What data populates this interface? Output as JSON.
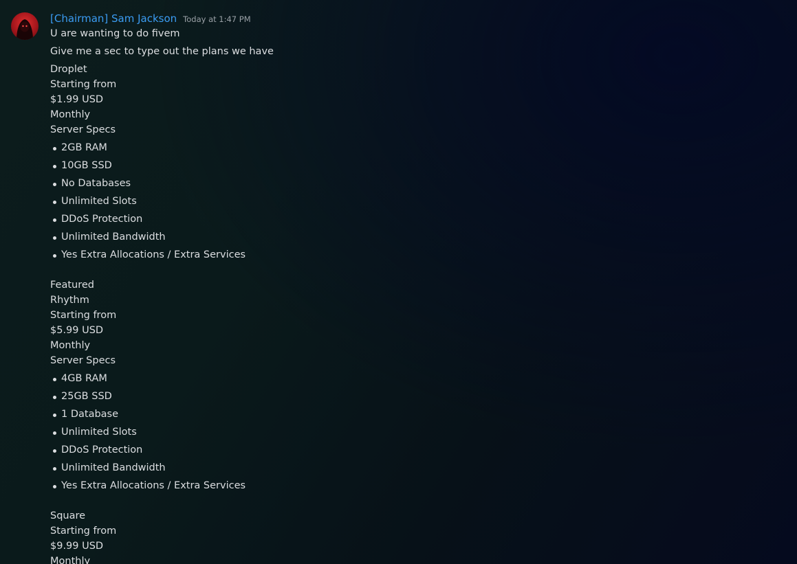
{
  "message": {
    "username": "[Chairman] Sam Jackson",
    "timestamp": "Today at 1:47 PM",
    "lines": [
      "U are wanting to do fivem",
      "Give me a sec to type out the plans we have"
    ]
  },
  "plans": [
    {
      "prefix": "",
      "name": "Droplet",
      "starting_label": "Starting from",
      "price": "$1.99 USD",
      "period": "Monthly",
      "specs_label": "Server Specs",
      "specs": [
        "2GB RAM",
        "10GB SSD",
        "No Databases",
        "Unlimited Slots",
        "DDoS Protection",
        "Unlimited Bandwidth",
        "Yes Extra Allocations / Extra Services"
      ]
    },
    {
      "prefix": "Featured",
      "name": "Rhythm",
      "starting_label": "Starting from",
      "price": "$5.99 USD",
      "period": "Monthly",
      "specs_label": "Server Specs",
      "specs": [
        "4GB RAM",
        "25GB SSD",
        "1 Database",
        "Unlimited Slots",
        "DDoS Protection",
        "Unlimited Bandwidth",
        "Yes Extra Allocations / Extra Services"
      ]
    },
    {
      "prefix": "",
      "name": "Square",
      "starting_label": "Starting from",
      "price": "$9.99 USD",
      "period": "Monthly"
    }
  ],
  "colors": {
    "username": "#3b9cf3",
    "text": "#dcdee1",
    "timestamp": "#9aa0a6"
  },
  "icons": {
    "avatar": "hooded-figure-avatar"
  }
}
